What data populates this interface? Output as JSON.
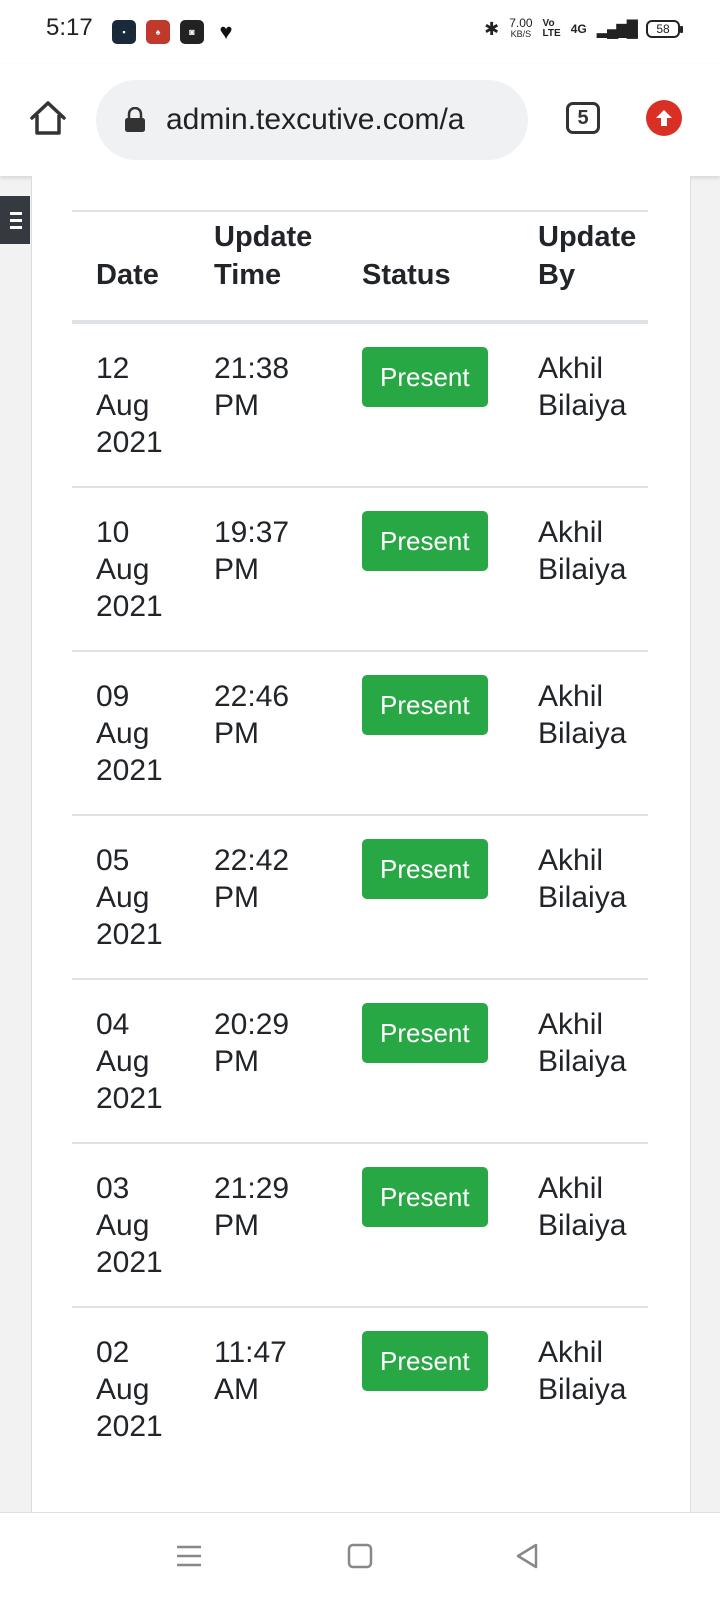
{
  "status_bar": {
    "time": "5:17",
    "net_speed_value": "7.00",
    "net_speed_unit": "KB/S",
    "volte_top": "Vo",
    "volte_bottom": "LTE",
    "network": "4G",
    "battery": "58"
  },
  "browser": {
    "url": "admin.texcutive.com/a",
    "tab_count": "5"
  },
  "table": {
    "headers": {
      "date": "Date",
      "time_line1": "Update",
      "time_line2": "Time",
      "status": "Status",
      "by_line1": "Update",
      "by_line2": "By"
    },
    "rows": [
      {
        "day": "12",
        "month": "Aug",
        "year": "2021",
        "time": "21:38",
        "ampm": "PM",
        "status": "Present",
        "first": "Akhil",
        "last": "Bilaiya"
      },
      {
        "day": "10",
        "month": "Aug",
        "year": "2021",
        "time": "19:37",
        "ampm": "PM",
        "status": "Present",
        "first": "Akhil",
        "last": "Bilaiya"
      },
      {
        "day": "09",
        "month": "Aug",
        "year": "2021",
        "time": "22:46",
        "ampm": "PM",
        "status": "Present",
        "first": "Akhil",
        "last": "Bilaiya"
      },
      {
        "day": "05",
        "month": "Aug",
        "year": "2021",
        "time": "22:42",
        "ampm": "PM",
        "status": "Present",
        "first": "Akhil",
        "last": "Bilaiya"
      },
      {
        "day": "04",
        "month": "Aug",
        "year": "2021",
        "time": "20:29",
        "ampm": "PM",
        "status": "Present",
        "first": "Akhil",
        "last": "Bilaiya"
      },
      {
        "day": "03",
        "month": "Aug",
        "year": "2021",
        "time": "21:29",
        "ampm": "PM",
        "status": "Present",
        "first": "Akhil",
        "last": "Bilaiya"
      },
      {
        "day": "02",
        "month": "Aug",
        "year": "2021",
        "time": "11:47",
        "ampm": "AM",
        "status": "Present",
        "first": "Akhil",
        "last": "Bilaiya"
      }
    ]
  },
  "colors": {
    "badge_success": "#28a745",
    "update_button": "#d93025",
    "sidebar_toggle": "#343a40"
  },
  "icons": [
    "home-icon",
    "lock-icon",
    "tabs-icon",
    "update-arrow-icon",
    "hamburger-icon",
    "nav-recents-icon",
    "nav-home-icon",
    "nav-back-icon"
  ]
}
